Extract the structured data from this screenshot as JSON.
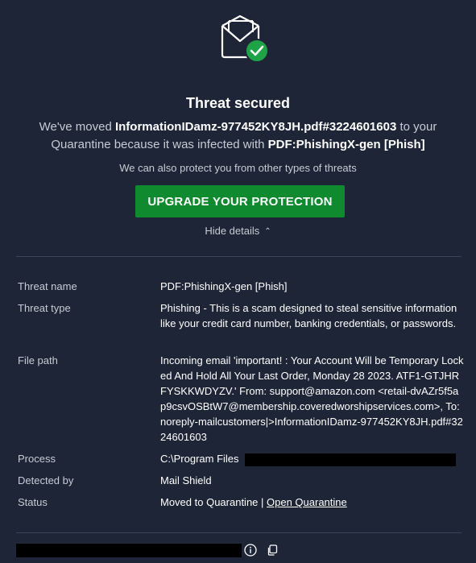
{
  "header": {
    "title": "Threat secured",
    "message_prefix": "We've moved ",
    "file_name": "InformationIDamz-977452KY8JH.pdf#3224601603",
    "message_mid1": " to your Quarantine because it was infected with ",
    "threat_name": "PDF:PhishingX-gen [Phish]",
    "subtitle": "We can also protect you from other types of threats",
    "upgrade_button": "UPGRADE YOUR PROTECTION",
    "hide_details": "Hide details"
  },
  "details": {
    "threat_name_label": "Threat name",
    "threat_name_value": "PDF:PhishingX-gen [Phish]",
    "threat_type_label": "Threat type",
    "threat_type_value": "Phishing - This is a scam designed to steal sensitive information like your credit card number, banking credentials, or passwords.",
    "file_path_label": "File path",
    "file_path_value": "Incoming email 'important! : Your Account Will be Temporary Locked And Hold All Your Last Order, Monday 28 2023. ATF1-GTJHRFYSKKWDYZV.' From: support@amazon.com <retail-dvAZr5f5ap9csvOSBtW7@membership.coveredworshipservices.com>, To: noreply-mailcustomers|>InformationIDamz-977452KY8JH.pdf#3224601603",
    "process_label": "Process",
    "process_value": "C:\\Program Files",
    "detected_by_label": "Detected by",
    "detected_by_value": "Mail Shield",
    "status_label": "Status",
    "status_value": "Moved to Quarantine | ",
    "status_link": "Open Quarantine"
  },
  "icons": {
    "envelope": "envelope-check-icon",
    "info": "info-icon",
    "copy": "copy-icon",
    "chevron": "chevron-up-icon"
  },
  "colors": {
    "background": "#1d2537",
    "accent_green": "#0f8a2f",
    "check_green": "#1ea446",
    "muted_text": "#c7cbd4"
  }
}
